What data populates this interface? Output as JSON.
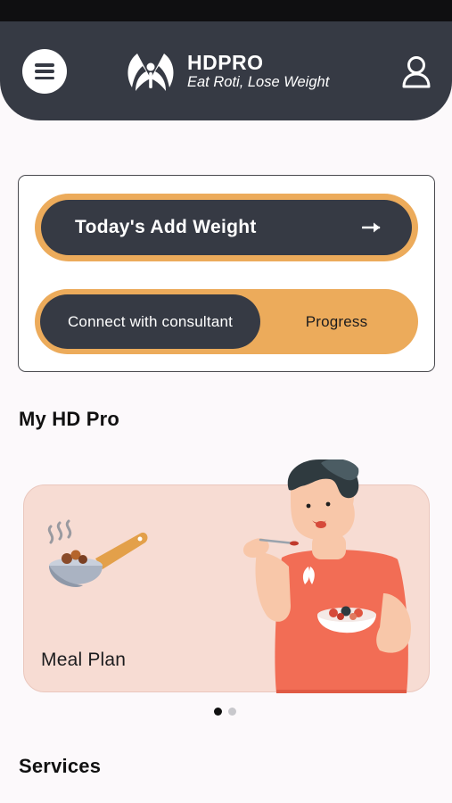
{
  "header": {
    "brand_name": "HDPRO",
    "tagline": "Eat Roti, Lose Weight",
    "menu_icon": "hamburger-menu-icon",
    "profile_icon": "user-profile-icon",
    "colors": {
      "header_bg": "#363a44",
      "accent": "#ecab5b"
    }
  },
  "actions": {
    "add_weight_label": "Today's Add Weight",
    "add_weight_icon": "arrow-right-icon",
    "tabs": [
      {
        "label": "Connect with consultant",
        "selected": true
      },
      {
        "label": "Progress",
        "selected": false
      }
    ]
  },
  "my_hd_pro": {
    "title": "My HD Pro",
    "slides": [
      {
        "label": "Meal Plan",
        "bg_color": "#f7dcd3"
      }
    ],
    "pagination": {
      "count": 2,
      "active_index": 0
    }
  },
  "services": {
    "title": "Services"
  }
}
